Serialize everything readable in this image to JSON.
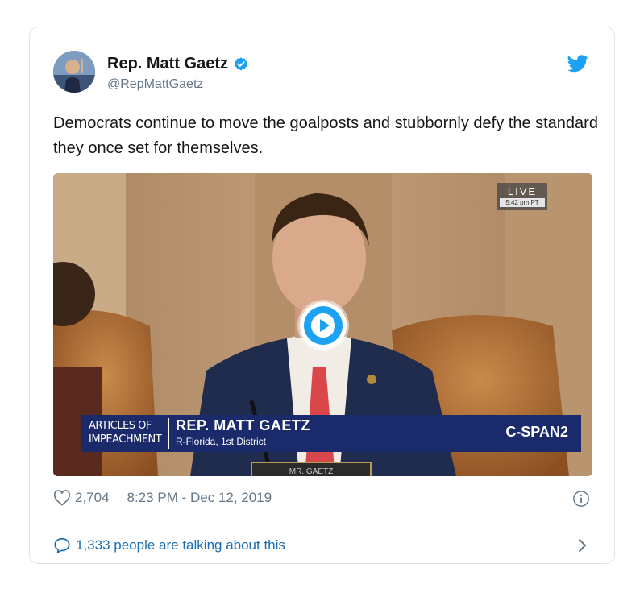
{
  "author": {
    "display_name": "Rep. Matt Gaetz",
    "handle": "@RepMattGaetz",
    "verified": true
  },
  "tweet": {
    "text": "Democrats continue to move the goalposts and stubbornly defy the standard they once set for themselves."
  },
  "video": {
    "live_label": "LIVE",
    "live_time": "5:42 pm PT",
    "chyron_topic_line1": "ARTICLES OF",
    "chyron_topic_line2": "IMPEACHMENT",
    "chyron_name": "REP. MATT GAETZ",
    "chyron_subtitle": "R-Florida, 1st District",
    "network": "C-SPAN2",
    "nameplate": "MR. GAETZ"
  },
  "footer": {
    "like_count": "2,704",
    "timestamp": "8:23 PM - Dec 12, 2019",
    "talking": "1,333 people are talking about this"
  },
  "icons": {
    "verified": "verified-badge-icon",
    "brand": "twitter-bird-icon",
    "like": "heart-icon",
    "info": "info-icon",
    "reply": "speech-bubble-icon",
    "play": "play-icon",
    "more": "chevron-right-icon"
  },
  "colors": {
    "brand_blue": "#1da1f2",
    "link_blue": "#1b6cb0",
    "muted": "#657786",
    "text": "#14171a",
    "chyron": "#1b2a6b"
  }
}
